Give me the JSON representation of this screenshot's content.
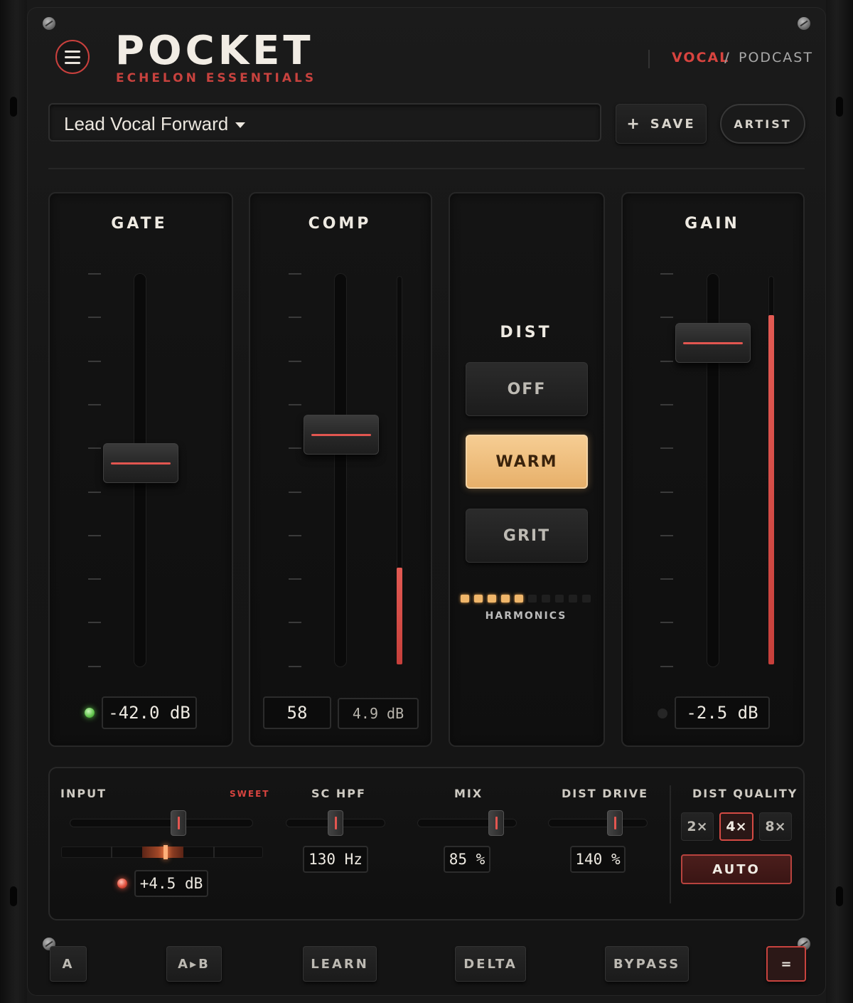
{
  "header": {
    "brand": "POCKET",
    "subtitle": "ECHELON ESSENTIALS",
    "modes": [
      "VOCAL",
      "PODCAST"
    ],
    "mode_separator": "/",
    "active_mode": "VOCAL",
    "menu_icon": "hamburger-menu-icon"
  },
  "preset": {
    "name": "Lead Vocal Forward",
    "save_label": "SAVE",
    "save_icon": "+",
    "artist_label": "ARTIST"
  },
  "channels": {
    "gate": {
      "title": "GATE",
      "readout": "-42.0 dB",
      "fader_level": 0.52,
      "led": "green"
    },
    "comp": {
      "title": "COMP",
      "readout": "58",
      "reduction": "4.9 dB",
      "fader_level": 0.6,
      "meter_level": 0.25
    },
    "dist": {
      "title": "DIST",
      "options": [
        "OFF",
        "WARM",
        "GRIT"
      ],
      "selected": "WARM",
      "harmonics_label": "HARMONICS",
      "harmonics_lit": 5,
      "harmonics_total": 10
    },
    "gain": {
      "title": "GAIN",
      "readout": "-2.5 dB",
      "fader_level": 0.86,
      "meter_level": 0.9,
      "led": "off"
    }
  },
  "bottom": {
    "input": {
      "label": "INPUT",
      "badge": "SWEET",
      "value": "+4.5 dB",
      "slider_level": 0.6
    },
    "sc_hpf": {
      "label": "SC HPF",
      "value": "130 Hz",
      "slider_level": 0.5
    },
    "mix": {
      "label": "MIX",
      "value": "85 %",
      "slider_level": 0.85
    },
    "dist_drive": {
      "label": "DIST DRIVE",
      "value": "140 %",
      "slider_level": 0.7
    },
    "dist_quality": {
      "label": "DIST QUALITY",
      "options": [
        "2×",
        "4×",
        "8×"
      ],
      "selected": "4×",
      "auto_label": "AUTO"
    }
  },
  "footer": {
    "a": "A",
    "ab": "A▸B",
    "learn": "LEARN",
    "delta": "DELTA",
    "bypass": "BYPASS",
    "eq": "="
  },
  "colors": {
    "accent_red": "#d8443f",
    "warm_active": "#f0c07f",
    "meter_red": "#e35a53",
    "led_green": "#5fc24a",
    "harmonics_amber": "#f0b66a"
  }
}
